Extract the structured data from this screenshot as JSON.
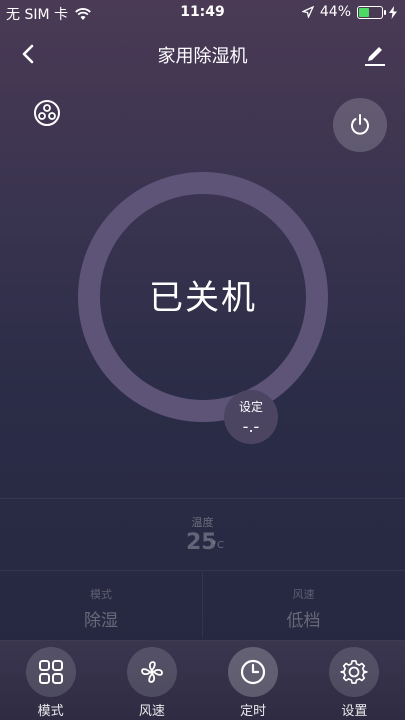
{
  "status_bar": {
    "carrier": "无 SIM 卡",
    "time": "11:49",
    "battery_percent": "44%",
    "battery_level": 0.44,
    "battery_color": "#4cd964"
  },
  "nav": {
    "title": "家用除湿机",
    "back_icon": "chevron-left-icon",
    "edit_icon": "pencil-icon"
  },
  "controls": {
    "fan_mode_icon": "fan-mode-icon",
    "power_icon": "power-icon"
  },
  "dial": {
    "status": "已关机",
    "ring_color": "#5e5478",
    "set_label": "设定",
    "set_value": "-.-"
  },
  "temperature": {
    "label": "温度",
    "value": "25",
    "unit": "°C"
  },
  "mode_speed": {
    "mode_label": "模式",
    "mode_value": "除湿",
    "speed_label": "风速",
    "speed_value": "低档"
  },
  "tabs": [
    {
      "label": "模式",
      "icon": "grid-icon"
    },
    {
      "label": "风速",
      "icon": "fan-icon"
    },
    {
      "label": "定时",
      "icon": "clock-icon"
    },
    {
      "label": "设置",
      "icon": "gear-icon"
    }
  ]
}
